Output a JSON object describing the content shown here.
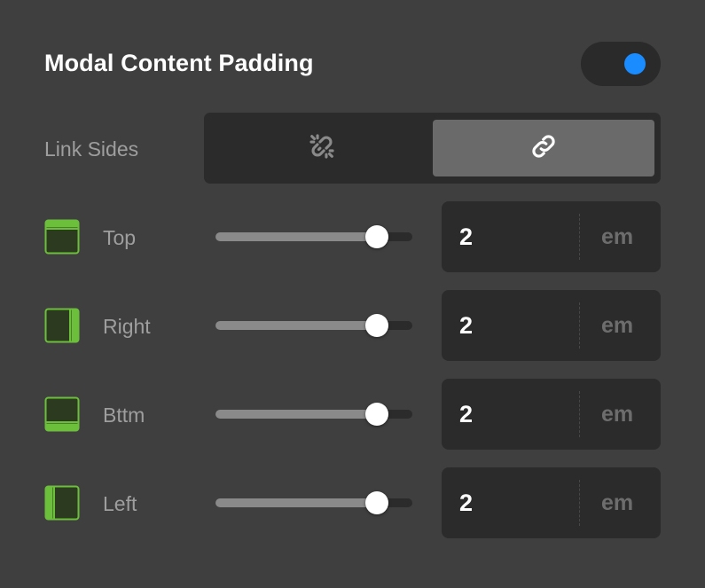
{
  "panel": {
    "title": "Modal Content Padding",
    "enabled": true
  },
  "link_sides": {
    "label": "Link Sides",
    "options": [
      {
        "icon": "unlink-icon",
        "selected": false
      },
      {
        "icon": "link-icon",
        "selected": true
      }
    ]
  },
  "rows": [
    {
      "label": "Top",
      "icon": "padding-top-icon",
      "value": "2",
      "unit": "em",
      "slider_fraction": 0.82
    },
    {
      "label": "Right",
      "icon": "padding-right-icon",
      "value": "2",
      "unit": "em",
      "slider_fraction": 0.82
    },
    {
      "label": "Bttm",
      "icon": "padding-bottom-icon",
      "value": "2",
      "unit": "em",
      "slider_fraction": 0.82
    },
    {
      "label": "Left",
      "icon": "padding-left-icon",
      "value": "2",
      "unit": "em",
      "slider_fraction": 0.82
    }
  ],
  "colors": {
    "accent_blue": "#1a8cff",
    "icon_green": "#6cbf3b",
    "icon_fill": "#2c3a1f",
    "background": "#3f3f3f",
    "control_bg": "#2b2b2b"
  }
}
